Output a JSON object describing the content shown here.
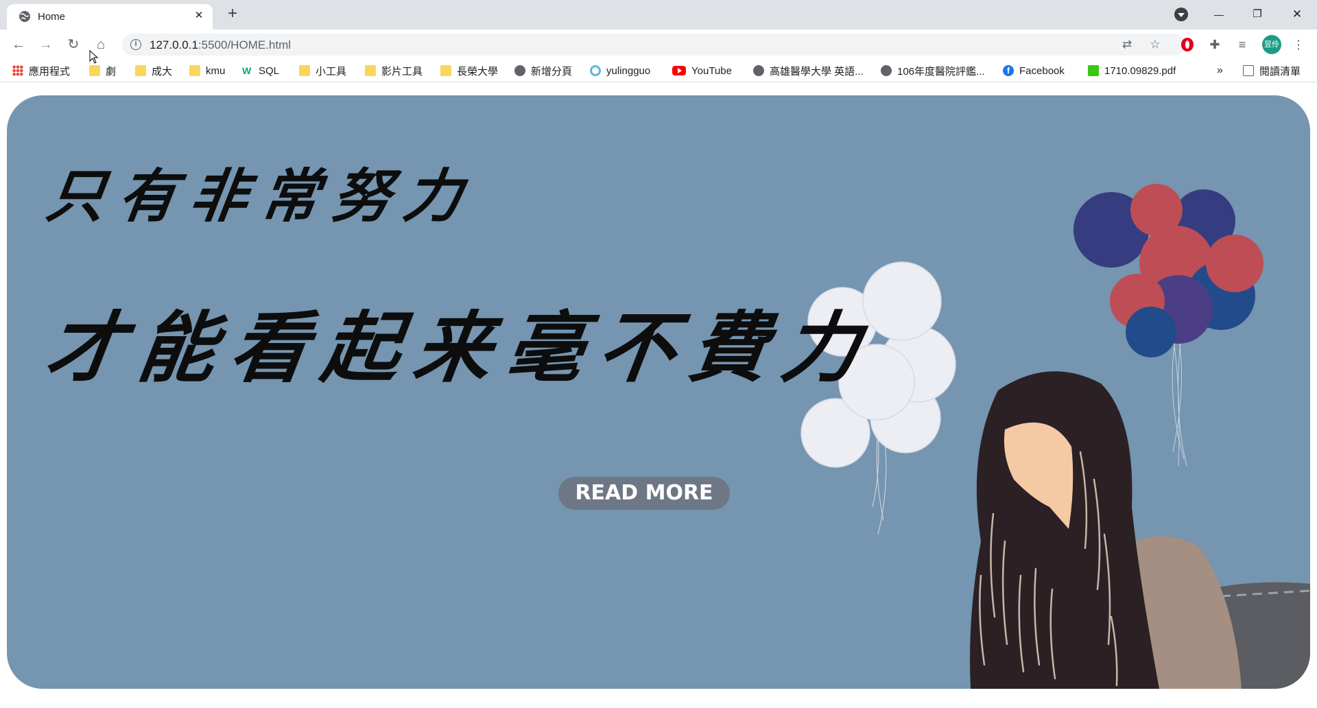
{
  "browser": {
    "tab": {
      "title": "Home",
      "close_glyph": "✕"
    },
    "new_tab_glyph": "+",
    "window_controls": {
      "minimize": "—",
      "restore": "❐",
      "close": "✕"
    },
    "address": {
      "host": "127.0.0.1",
      "path": ":5500/HOME.html"
    },
    "profile_label": "昱伶",
    "more_glyph": "⋮"
  },
  "bookmarks": [
    {
      "label": "應用程式",
      "icon": "apps-grid-icon"
    },
    {
      "label": "劇",
      "icon": "folder-icon"
    },
    {
      "label": "成大",
      "icon": "folder-icon"
    },
    {
      "label": "kmu",
      "icon": "folder-icon"
    },
    {
      "label": "SQL",
      "icon": "w3schools-icon"
    },
    {
      "label": "小工具",
      "icon": "folder-icon"
    },
    {
      "label": "影片工具",
      "icon": "folder-icon"
    },
    {
      "label": "長榮大學",
      "icon": "folder-icon"
    },
    {
      "label": "新增分頁",
      "icon": "globe-icon"
    },
    {
      "label": "yulingguo",
      "icon": "ring-icon"
    },
    {
      "label": "YouTube",
      "icon": "youtube-icon"
    },
    {
      "label": "高雄醫學大學 英語...",
      "icon": "globe-icon"
    },
    {
      "label": "106年度醫院評鑑...",
      "icon": "globe-icon"
    },
    {
      "label": "Facebook",
      "icon": "facebook-icon"
    },
    {
      "label": "1710.09829.pdf",
      "icon": "pdf-icon"
    }
  ],
  "bookmarks_overflow": "»",
  "reading_list": "閱讀清單",
  "hero": {
    "line1": "只有非常努力",
    "line2": "才能看起来毫不費力",
    "button": "READ MORE",
    "colors": {
      "background": "#7595b0",
      "white_balloons": "#eceef4",
      "navy_balloon": "#353c80",
      "red_balloon": "#bf4d55",
      "blue_balloon": "#214b8a",
      "purple_balloon": "#4c3e85",
      "hair": "#2b2124",
      "face": "#f5c9a4",
      "sweater": "#a48f82",
      "sofa": "#5b5d62"
    }
  }
}
